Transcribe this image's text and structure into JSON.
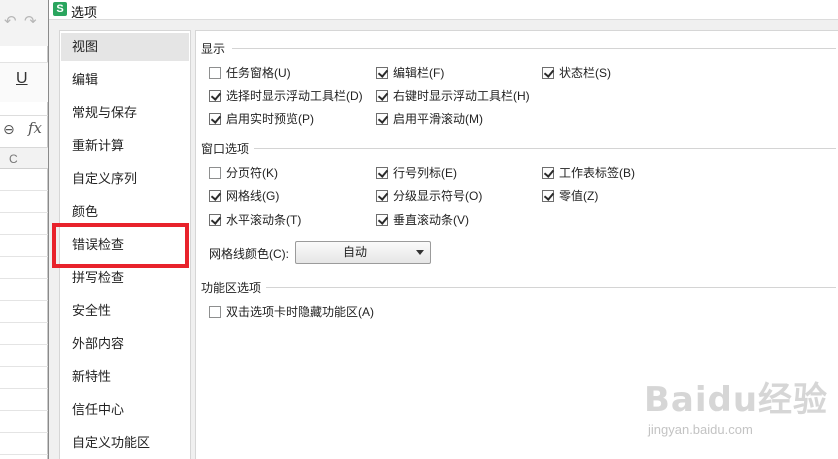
{
  "dialog": {
    "title": "选项",
    "app_icon_letter": "S"
  },
  "background_app": {
    "undo_icon": "undo-icon",
    "redo_icon": "redo-icon",
    "underline_label": "U",
    "fx_label": "fx",
    "column_header": "C"
  },
  "nav": {
    "items": [
      {
        "label": "视图",
        "active": true
      },
      {
        "label": "编辑"
      },
      {
        "label": "常规与保存"
      },
      {
        "label": "重新计算"
      },
      {
        "label": "自定义序列"
      },
      {
        "label": "颜色"
      },
      {
        "label": "错误检查"
      },
      {
        "label": "拼写检查"
      },
      {
        "label": "安全性"
      },
      {
        "label": "外部内容"
      },
      {
        "label": "新特性"
      },
      {
        "label": "信任中心"
      },
      {
        "label": "自定义功能区"
      }
    ],
    "highlight_color": "#e8222b"
  },
  "display": {
    "title": "显示",
    "options": [
      {
        "label": "任务窗格(U)",
        "checked": false
      },
      {
        "label": "编辑栏(F)",
        "checked": true
      },
      {
        "label": "状态栏(S)",
        "checked": true
      },
      {
        "label": "选择时显示浮动工具栏(D)",
        "checked": true
      },
      {
        "label": "右键时显示浮动工具栏(H)",
        "checked": true
      },
      {
        "label": "启用实时预览(P)",
        "checked": true
      },
      {
        "label": "启用平滑滚动(M)",
        "checked": true
      }
    ]
  },
  "window_options": {
    "title": "窗口选项",
    "options": [
      {
        "label": "分页符(K)",
        "checked": false
      },
      {
        "label": "行号列标(E)",
        "checked": true
      },
      {
        "label": "工作表标签(B)",
        "checked": true
      },
      {
        "label": "网格线(G)",
        "checked": true
      },
      {
        "label": "分级显示符号(O)",
        "checked": true
      },
      {
        "label": "零值(Z)",
        "checked": true
      },
      {
        "label": "水平滚动条(T)",
        "checked": true
      },
      {
        "label": "垂直滚动条(V)",
        "checked": true
      }
    ],
    "gridline_color_label": "网格线颜色(C):",
    "gridline_color_value": "自动"
  },
  "ribbon_options": {
    "title": "功能区选项",
    "options": [
      {
        "label": "双击选项卡时隐藏功能区(A)",
        "checked": false
      }
    ]
  },
  "watermark": {
    "main": "Baidu经验",
    "sub": "jingyan.baidu.com"
  }
}
